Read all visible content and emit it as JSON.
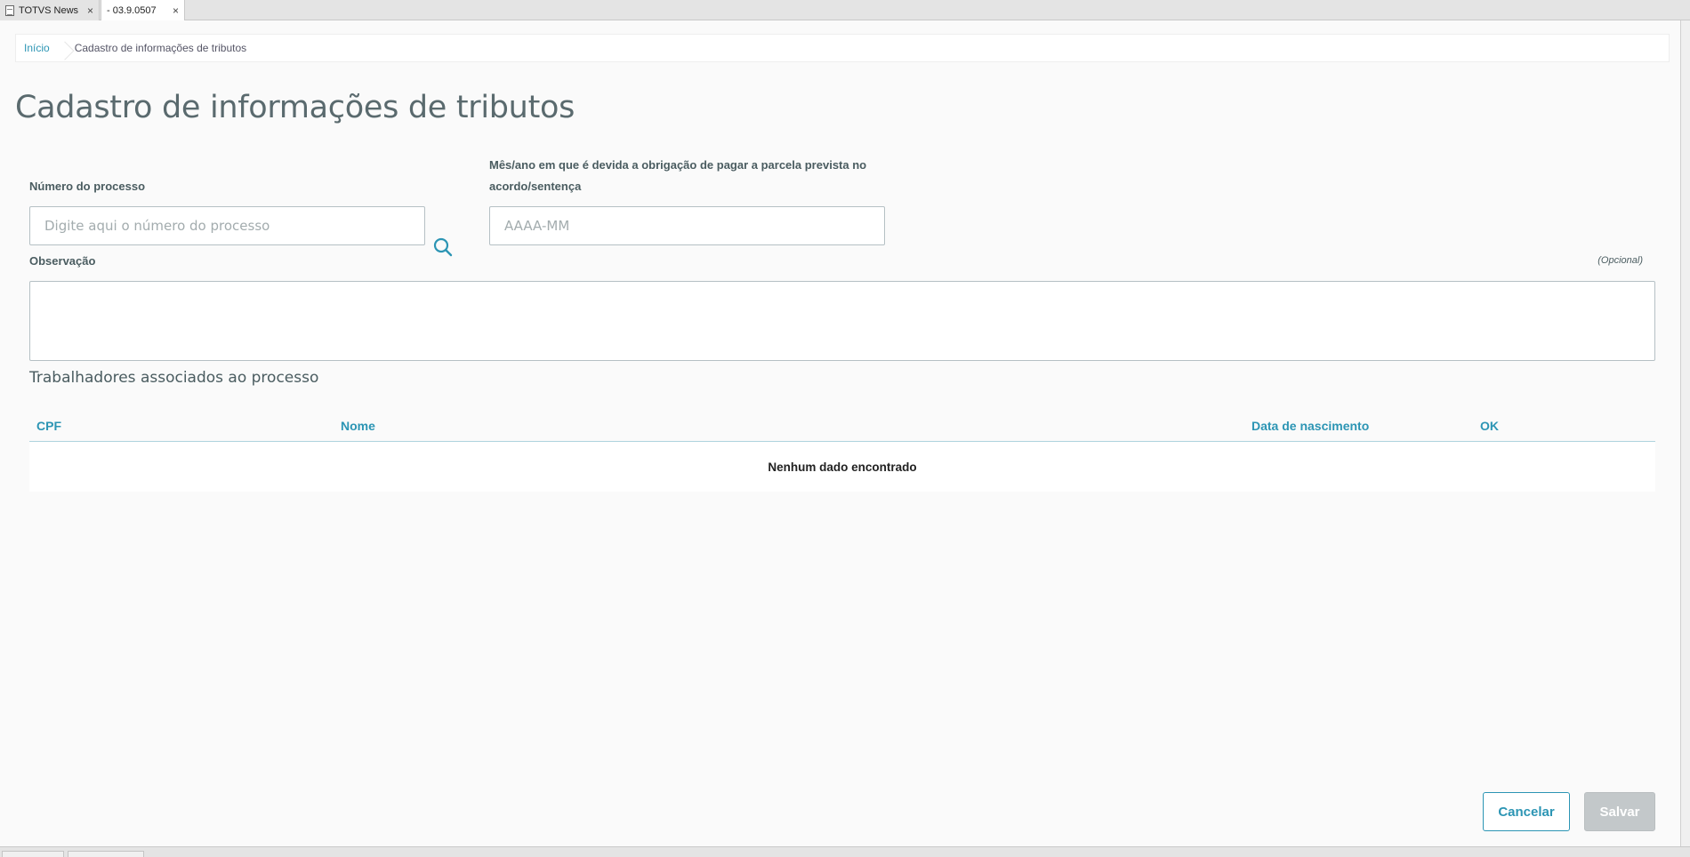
{
  "tabs": [
    {
      "label": "TOTVS News",
      "close": "×",
      "icon": "document-icon"
    },
    {
      "label": "- 03.9.0507",
      "close": "×"
    }
  ],
  "breadcrumb": {
    "home": "Início",
    "current": "Cadastro de informações de tributos"
  },
  "page": {
    "title": "Cadastro de informações de tributos"
  },
  "form": {
    "processo": {
      "label": "Número do processo",
      "placeholder": "Digite aqui o número do processo",
      "value": ""
    },
    "periodo": {
      "label_line1": "Mês/ano em que é devida a obrigação de pagar a parcela prevista no",
      "label_line2": "acordo/sentença",
      "placeholder": "AAAA-MM",
      "value": ""
    },
    "observacao": {
      "label": "Observação",
      "optional": "(Opcional)",
      "value": ""
    }
  },
  "workers": {
    "title": "Trabalhadores associados ao processo",
    "columns": [
      "CPF",
      "Nome",
      "Data de nascimento",
      "OK"
    ],
    "rows": [],
    "empty_message": "Nenhum dado encontrado"
  },
  "actions": {
    "cancel": "Cancelar",
    "save": "Salvar"
  },
  "colors": {
    "primary": "#2c95b4",
    "text": "#4a5c60",
    "disabled": "#c3c8ca"
  }
}
